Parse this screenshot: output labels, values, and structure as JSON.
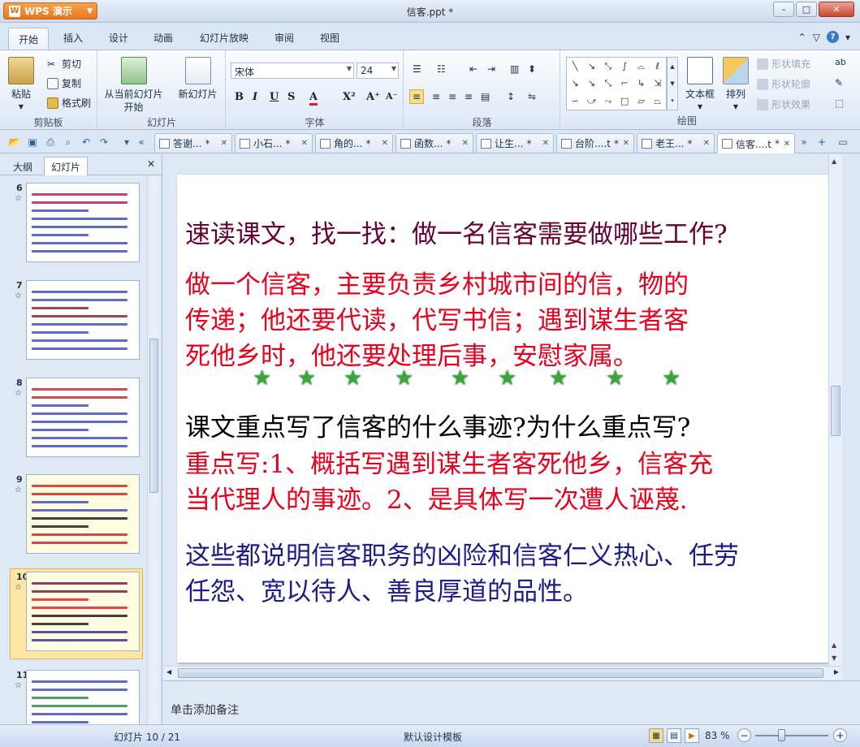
{
  "titlebar": {
    "app_name": "WPS 演示",
    "doc_title": "信客.ppt *"
  },
  "menu": {
    "tabs": [
      "开始",
      "插入",
      "设计",
      "动画",
      "幻灯片放映",
      "审阅",
      "视图"
    ],
    "active": "开始"
  },
  "ribbon": {
    "clipboard": {
      "paste": "粘贴",
      "cut": "剪切",
      "copy": "复制",
      "format_painter": "格式刷",
      "label": "剪贴板"
    },
    "slides": {
      "from_current_line1": "从当前幻灯片",
      "from_current_line2": "开始",
      "new_slide": "新幻灯片",
      "label": "幻灯片"
    },
    "font": {
      "name": "宋体",
      "size": "24",
      "label": "字体"
    },
    "paragraph": {
      "label": "段落"
    },
    "drawing": {
      "textbox": "文本框",
      "arrange": "排列",
      "fill": "形状填充",
      "outline": "形状轮廓",
      "effect": "形状效果",
      "label": "绘图"
    }
  },
  "doc_tabs": [
    {
      "label": "答谢...",
      "mark": "*"
    },
    {
      "label": "小石...",
      "mark": "*"
    },
    {
      "label": "角的...",
      "mark": "*"
    },
    {
      "label": "函数...",
      "mark": "*"
    },
    {
      "label": "让生...",
      "mark": "*"
    },
    {
      "label": "台阶....t",
      "mark": "*"
    },
    {
      "label": "老王...",
      "mark": "*"
    },
    {
      "label": "信客....t",
      "mark": "*"
    }
  ],
  "left_panel": {
    "tabs": [
      "大纲",
      "幻灯片"
    ],
    "active": "幻灯片",
    "thumbnails": [
      {
        "num": "6"
      },
      {
        "num": "7"
      },
      {
        "num": "8"
      },
      {
        "num": "9"
      },
      {
        "num": "10"
      },
      {
        "num": "11"
      }
    ],
    "selected_num": "10"
  },
  "slide": {
    "question1": "速读课文，找一找：做一名信客需要做哪些工作?",
    "answer1_lines": [
      "做一个信客，主要负责乡村城市间的信，物的",
      "传递；他还要代读，代写书信；遇到谋生者客",
      "死他乡时，他还要处理后事，安慰家属。"
    ],
    "question2": "课文重点写了信客的什么事迹?为什么重点写?",
    "answer2_lines": [
      "重点写:1、概括写遇到谋生者客死他乡，信客充",
      "当代理人的事迹。2、是具体写一次遭人诬蔑."
    ],
    "summary_lines": [
      "这些都说明信客职务的凶险和信客仁义热心、任劳",
      "任怨、宽以待人、善良厚道的品性。"
    ],
    "star_count": 9
  },
  "notes": {
    "placeholder": "单击添加备注"
  },
  "status": {
    "slide_info": "幻灯片 10 / 21",
    "template": "默认设计模板",
    "zoom": "83 %"
  },
  "colors": {
    "question": "#660033",
    "answer": "#e8001c",
    "summary": "#1c1c8a",
    "star": "#3aa63a"
  }
}
